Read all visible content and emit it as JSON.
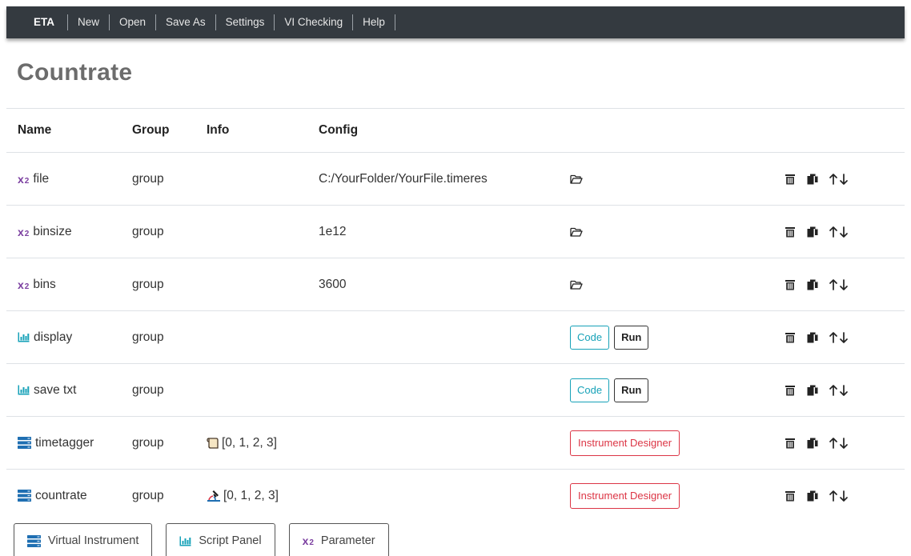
{
  "nav": {
    "brand": "ETA",
    "items": [
      "New",
      "Open",
      "Save As",
      "Settings",
      "VI Checking",
      "Help"
    ]
  },
  "page": {
    "title": "Countrate"
  },
  "table": {
    "headers": {
      "name": "Name",
      "group": "Group",
      "info": "Info",
      "config": "Config"
    },
    "rows": [
      {
        "icon": "parameter-icon",
        "name": "file",
        "group": "group",
        "info": "",
        "config": "C:/YourFolder/YourFile.timeres"
      },
      {
        "icon": "parameter-icon",
        "name": "binsize",
        "group": "group",
        "info": "",
        "config": "1e12"
      },
      {
        "icon": "parameter-icon",
        "name": "bins",
        "group": "group",
        "info": "",
        "config": "3600"
      },
      {
        "icon": "chart-icon",
        "name": "display",
        "group": "group",
        "info": "",
        "config": ""
      },
      {
        "icon": "chart-icon",
        "name": "save txt",
        "group": "group",
        "info": "",
        "config": ""
      },
      {
        "icon": "server-icon",
        "name": "timetagger",
        "group": "group",
        "info": "[0, 1, 2, 3]",
        "config": ""
      },
      {
        "icon": "server-icon",
        "name": "countrate",
        "group": "group",
        "info": "[0, 1, 2, 3]",
        "config": ""
      }
    ],
    "labels": {
      "x2": "x",
      "x2_sub": "2",
      "code": "Code",
      "run": "Run",
      "instrument_designer": "Instrument Designer",
      "up": "↑",
      "down": "↓"
    }
  },
  "bottom": {
    "virtual_instrument": "Virtual Instrument",
    "script_panel": "Script Panel",
    "parameter": "Parameter"
  },
  "colors": {
    "navbar": "#343a40",
    "parameter": "#7b3fa0",
    "chart": "#17a2b8",
    "server": "#1f6fb2",
    "code": "#17a2b8",
    "danger": "#dc3545"
  }
}
